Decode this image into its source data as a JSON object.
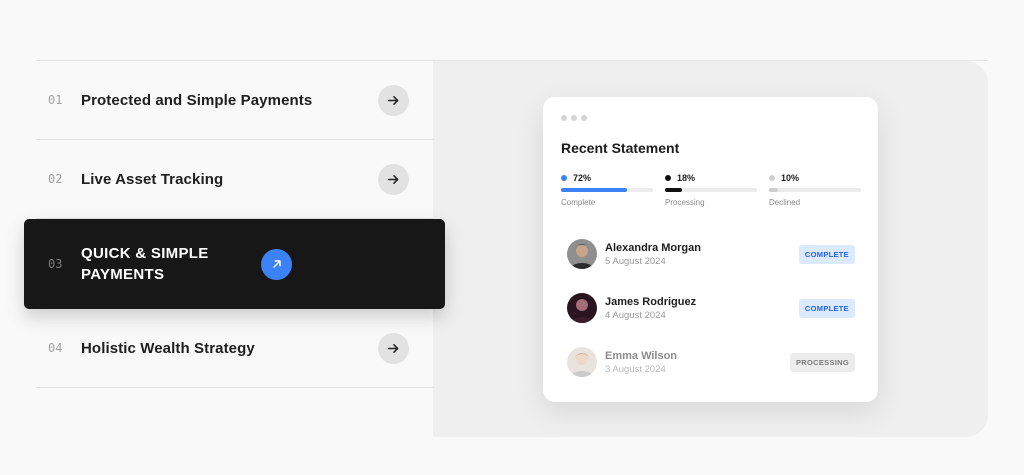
{
  "features": [
    {
      "num": "01",
      "title": "Protected and Simple Payments",
      "active": false
    },
    {
      "num": "02",
      "title": "Live Asset Tracking",
      "active": false
    },
    {
      "num": "03",
      "title": "QUICK & SIMPLE PAYMENTS",
      "active": true
    },
    {
      "num": "04",
      "title": "Holistic Wealth Strategy",
      "active": false
    }
  ],
  "statement": {
    "title": "Recent Statement",
    "stats": [
      {
        "pct": "72%",
        "value": 0.72,
        "label": "Complete",
        "color": "#3b82f6"
      },
      {
        "pct": "18%",
        "value": 0.18,
        "label": "Processing",
        "color": "#111111"
      },
      {
        "pct": "10%",
        "value": 0.1,
        "label": "Declined",
        "color": "#cfcfcf"
      }
    ],
    "transactions": [
      {
        "name": "Alexandra Morgan",
        "date": "5 August 2024",
        "status": "COMPLETE"
      },
      {
        "name": "James Rodriguez",
        "date": "4 August 2024",
        "status": "COMPLETE"
      },
      {
        "name": "Emma Wilson",
        "date": "3 August 2024",
        "status": "PROCESSING"
      }
    ]
  },
  "colors": {
    "accent": "#3b82f6",
    "complete_badge_bg": "#dbeafe",
    "complete_badge_text": "#2563eb",
    "processing_badge_bg": "#ececec",
    "processing_badge_text": "#7a7a7a"
  },
  "icons": {
    "arrow": "arrow-right-icon",
    "active_arrow": "arrow-up-right-icon"
  }
}
